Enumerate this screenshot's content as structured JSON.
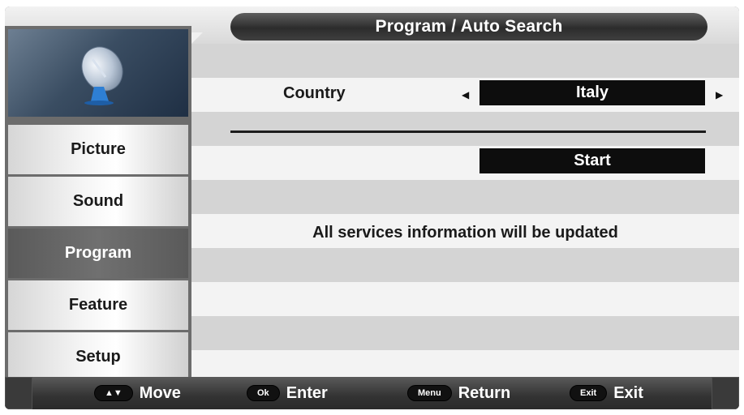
{
  "menu": {
    "title": "Program / Auto Search"
  },
  "sidebar": {
    "items": [
      {
        "label": "Picture"
      },
      {
        "label": "Sound"
      },
      {
        "label": "Program"
      },
      {
        "label": "Feature"
      },
      {
        "label": "Setup"
      }
    ],
    "active": "Program"
  },
  "country": {
    "label": "Country",
    "value": "Italy"
  },
  "start": {
    "label": "Start"
  },
  "info": {
    "message": "All services information will be updated"
  },
  "help": {
    "move": {
      "key": "▲▼",
      "label": "Move"
    },
    "enter": {
      "key": "Ok",
      "label": "Enter"
    },
    "return": {
      "key": "Menu",
      "label": "Return"
    },
    "exit": {
      "key": "Exit",
      "label": "Exit"
    }
  },
  "icons": {
    "logo": "satellite-dish-icon",
    "prev": "triangle-left-icon",
    "next": "triangle-right-icon"
  },
  "colors": {
    "active_item": "#6a6a6a",
    "value_box": "#0d0d0d",
    "title_bar": "#2c2c2c"
  }
}
